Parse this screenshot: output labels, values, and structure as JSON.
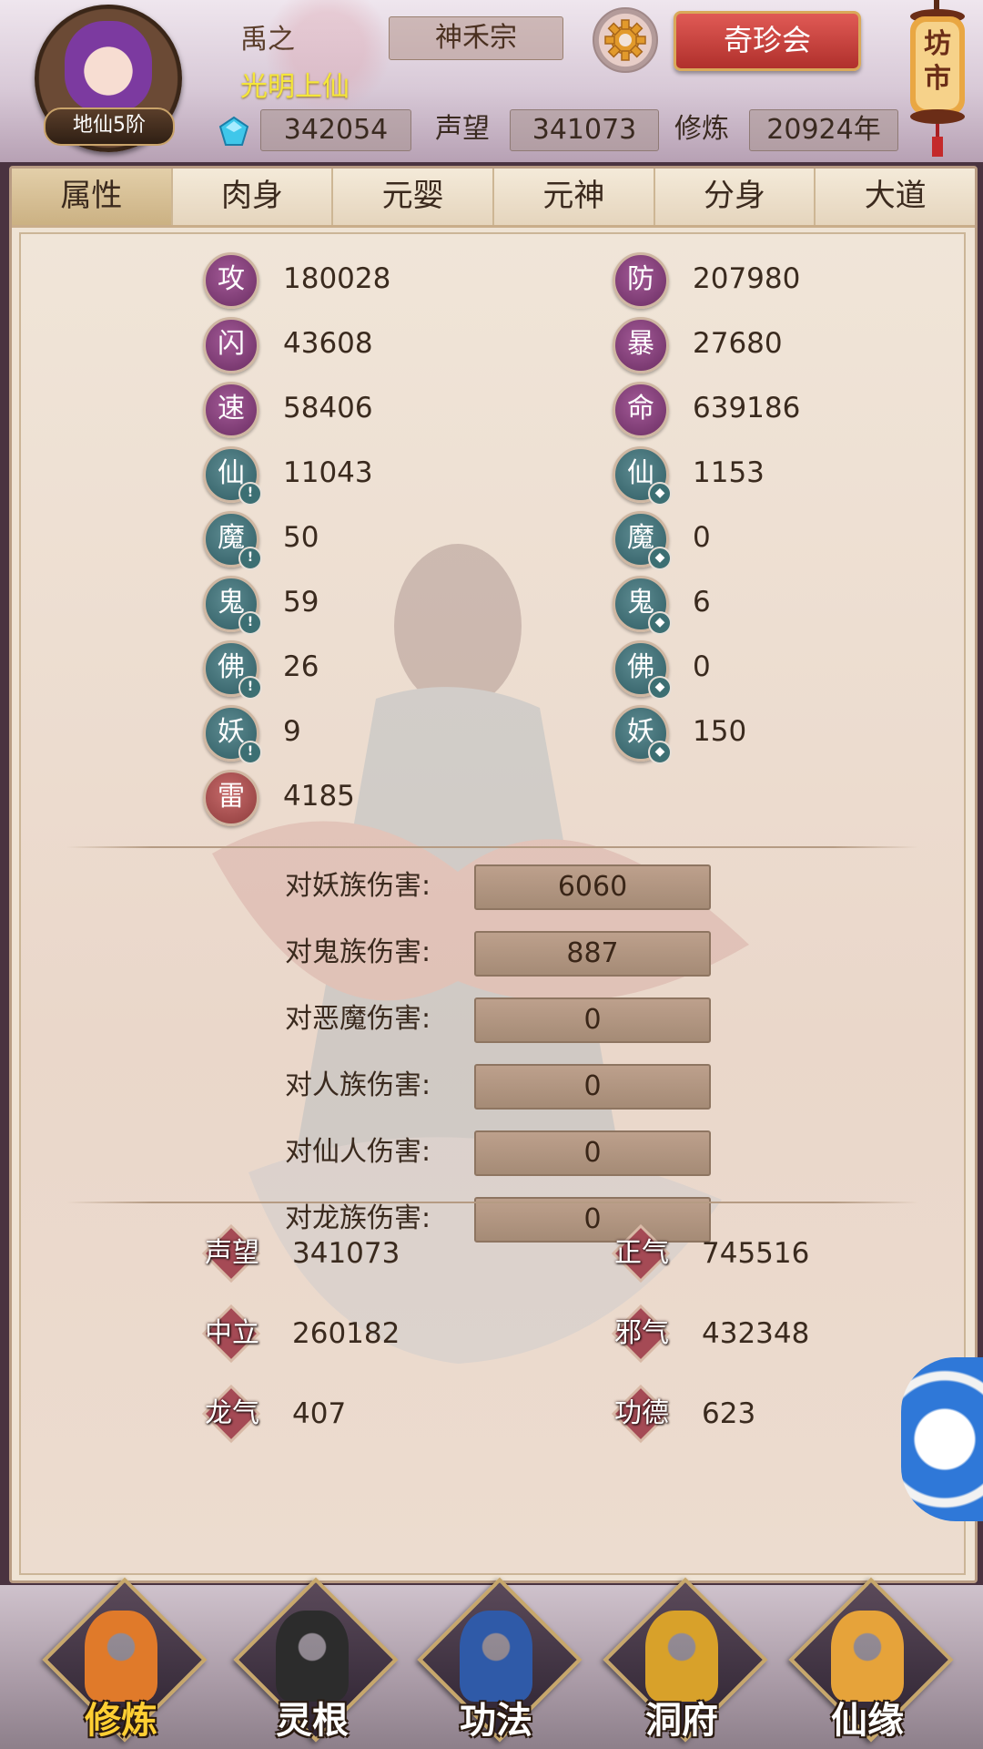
{
  "header": {
    "avatar_level": "地仙5阶",
    "player_name": "禹之",
    "player_title": "光明上仙",
    "sect": "神禾宗",
    "shop_button": "奇珍会",
    "market_label": "坊市",
    "gems": "342054",
    "reputation_label": "声望",
    "reputation": "341073",
    "cultivation_label": "修炼",
    "cultivation": "20924年"
  },
  "tabs": [
    "属性",
    "肉身",
    "元婴",
    "元神",
    "分身",
    "大道"
  ],
  "active_tab": "属性",
  "attributes": {
    "left": [
      {
        "icon": "攻",
        "value": "180028",
        "kind": "purple"
      },
      {
        "icon": "闪",
        "value": "43608",
        "kind": "purple"
      },
      {
        "icon": "速",
        "value": "58406",
        "kind": "purple"
      },
      {
        "icon": "仙",
        "value": "11043",
        "kind": "teal-attack"
      },
      {
        "icon": "魔",
        "value": "50",
        "kind": "teal-attack"
      },
      {
        "icon": "鬼",
        "value": "59",
        "kind": "teal-attack"
      },
      {
        "icon": "佛",
        "value": "26",
        "kind": "teal-attack"
      },
      {
        "icon": "妖",
        "value": "9",
        "kind": "teal-attack"
      },
      {
        "icon": "雷",
        "value": "4185",
        "kind": "red"
      }
    ],
    "right": [
      {
        "icon": "防",
        "value": "207980",
        "kind": "purple"
      },
      {
        "icon": "暴",
        "value": "27680",
        "kind": "purple"
      },
      {
        "icon": "命",
        "value": "639186",
        "kind": "purple"
      },
      {
        "icon": "仙",
        "value": "1153",
        "kind": "teal-defense"
      },
      {
        "icon": "魔",
        "value": "0",
        "kind": "teal-defense"
      },
      {
        "icon": "鬼",
        "value": "6",
        "kind": "teal-defense"
      },
      {
        "icon": "佛",
        "value": "0",
        "kind": "teal-defense"
      },
      {
        "icon": "妖",
        "value": "150",
        "kind": "teal-defense"
      }
    ]
  },
  "damage": [
    {
      "label": "对妖族伤害:",
      "value": "6060"
    },
    {
      "label": "对鬼族伤害:",
      "value": "887"
    },
    {
      "label": "对恶魔伤害:",
      "value": "0"
    },
    {
      "label": "对人族伤害:",
      "value": "0"
    },
    {
      "label": "对仙人伤害:",
      "value": "0"
    },
    {
      "label": "对龙族伤害:",
      "value": "0"
    }
  ],
  "reputation_stats": {
    "left": [
      {
        "label": "声望",
        "value": "341073"
      },
      {
        "label": "中立",
        "value": "260182"
      },
      {
        "label": "龙气",
        "value": "407"
      }
    ],
    "right": [
      {
        "label": "正气",
        "value": "745516"
      },
      {
        "label": "邪气",
        "value": "432348"
      },
      {
        "label": "功德",
        "value": "623"
      }
    ]
  },
  "nav": [
    {
      "label": "修炼",
      "icon": "monk-icon",
      "active": true
    },
    {
      "label": "灵根",
      "icon": "taiji-sword-icon",
      "active": false
    },
    {
      "label": "功法",
      "icon": "book-icon",
      "active": false
    },
    {
      "label": "洞府",
      "icon": "pagoda-icon",
      "active": false
    },
    {
      "label": "仙缘",
      "icon": "gourd-icon",
      "active": false
    }
  ],
  "colors": {
    "accent_red": "#c9413b",
    "title_yellow": "#f5e63a",
    "active_nav": "#ffcf33",
    "attr_purple": "#7a3572",
    "attr_teal": "#3c6f73",
    "attr_red": "#9a4242"
  }
}
